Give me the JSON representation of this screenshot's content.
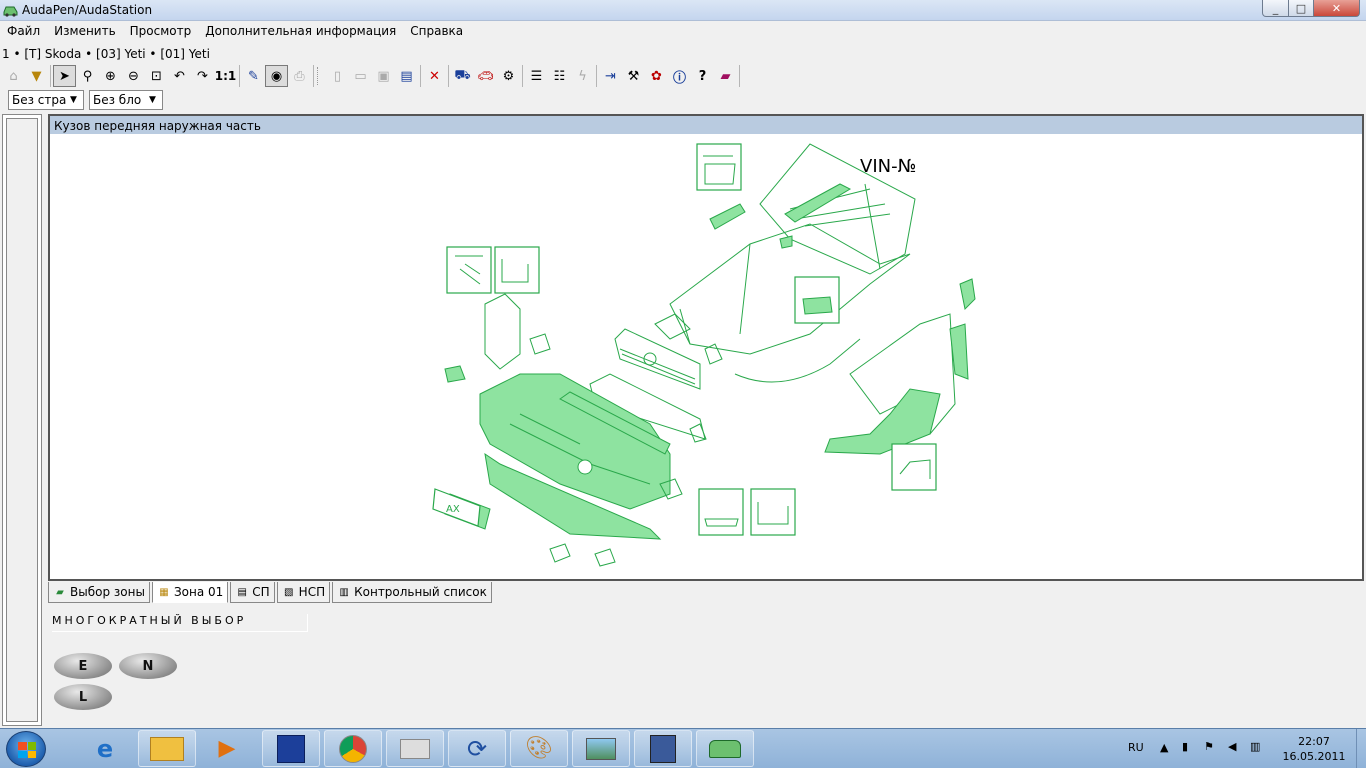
{
  "window": {
    "title": "AudaPen/AudaStation",
    "controls": {
      "minimize": "_",
      "maximize": "□",
      "close": "✕"
    }
  },
  "menu": [
    "Файл",
    "Изменить",
    "Просмотр",
    "Дополнительная информация",
    "Справка"
  ],
  "breadcrumb": "1 • [T] Skoda • [03] Yeti • [01] Yeti",
  "toolbar": {
    "zoom_label": "1:1",
    "icons": [
      "home-icon",
      "export-icon",
      "pointer-icon",
      "search-icon",
      "zoom-in-icon",
      "zoom-out-icon",
      "zoom-fit-icon",
      "undo-icon",
      "redo-icon",
      "actual-size-icon",
      "pen-icon",
      "eye-icon",
      "print-icon",
      "new-icon",
      "open-icon",
      "save-icon",
      "properties-icon",
      "delete-icon",
      "cart-icon",
      "car-icon",
      "settings-icon",
      "list-add-icon",
      "list-remove-icon",
      "lightning-icon",
      "import-icon",
      "tools-icon",
      "parts-icon",
      "info-icon",
      "help-icon",
      "book-icon"
    ]
  },
  "filters": {
    "country_combo": "Без стра",
    "block_combo": "Без бло"
  },
  "diagram": {
    "header": "Кузов передняя наружная часть",
    "vin_label": "VIN-№",
    "plate_text": "AX"
  },
  "tabs": [
    {
      "label": "Выбор зоны",
      "icon": "car-icon"
    },
    {
      "label": "Зона 01",
      "icon": "zone-icon"
    },
    {
      "label": "СП",
      "icon": "sp-icon"
    },
    {
      "label": "НСП",
      "icon": "nsp-icon"
    },
    {
      "label": "Контрольный список",
      "icon": "checklist-icon"
    }
  ],
  "bottom": {
    "multi_select_label": "МНОГОКРАТНЫЙ ВЫБОР",
    "buttons": [
      "E",
      "N",
      "L"
    ]
  },
  "taskbar": {
    "language": "RU",
    "time": "22:07",
    "date": "16.05.2011",
    "apps": [
      "ie-icon",
      "explorer-icon",
      "media-player-icon",
      "floppy-icon",
      "chrome-icon",
      "keyboard-icon",
      "sync-icon",
      "paint-icon",
      "photo-icon",
      "calculator-icon",
      "audastation-icon"
    ]
  },
  "colors": {
    "part_fill": "#8ee3a0",
    "part_stroke": "#2aa84b",
    "header_bg": "#b9cbe0"
  }
}
